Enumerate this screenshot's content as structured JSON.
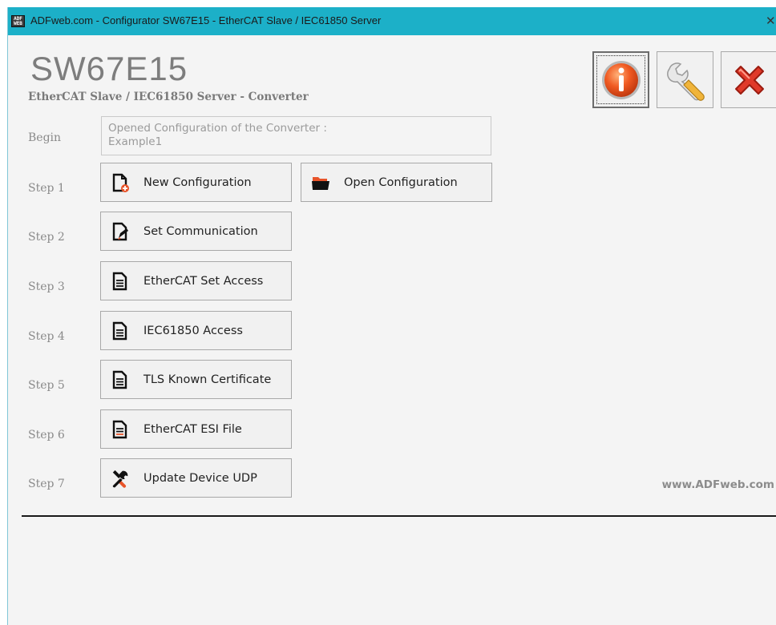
{
  "window": {
    "title": "ADFweb.com - Configurator SW67E15 - EtherCAT Slave / IEC61850 Server",
    "app_icon_text": "ADF WEB",
    "close_glyph": "✕"
  },
  "header": {
    "product": "SW67E15",
    "subtitle": "EtherCAT Slave / IEC61850 Server - Converter"
  },
  "toolbar": [
    {
      "name": "info-button",
      "icon": "info-icon"
    },
    {
      "name": "settings-button",
      "icon": "wrench-icon"
    },
    {
      "name": "exit-button",
      "icon": "red-x-icon"
    }
  ],
  "begin": {
    "label": "Begin",
    "line1": "Opened Configuration of the Converter :",
    "line2": "Example1"
  },
  "steps": [
    {
      "label": "Step 1",
      "button": "New Configuration",
      "icon": "new-document-icon",
      "extra_button": "Open Configuration",
      "extra_icon": "folder-icon"
    },
    {
      "label": "Step 2",
      "button": "Set Communication",
      "icon": "edit-document-icon"
    },
    {
      "label": "Step 3",
      "button": "EtherCAT Set Access",
      "icon": "document-icon"
    },
    {
      "label": "Step 4",
      "button": "IEC61850 Access",
      "icon": "document-icon"
    },
    {
      "label": "Step 5",
      "button": "TLS Known Certificate",
      "icon": "document-icon"
    },
    {
      "label": "Step 6",
      "button": "EtherCAT ESI File",
      "icon": "document-icon"
    },
    {
      "label": "Step 7",
      "button": "Update Device UDP",
      "icon": "tools-icon"
    }
  ],
  "footer": {
    "website": "www.ADFweb.com"
  },
  "colors": {
    "titlebar": "#1cb0c8",
    "accent_orange": "#e8542a"
  }
}
